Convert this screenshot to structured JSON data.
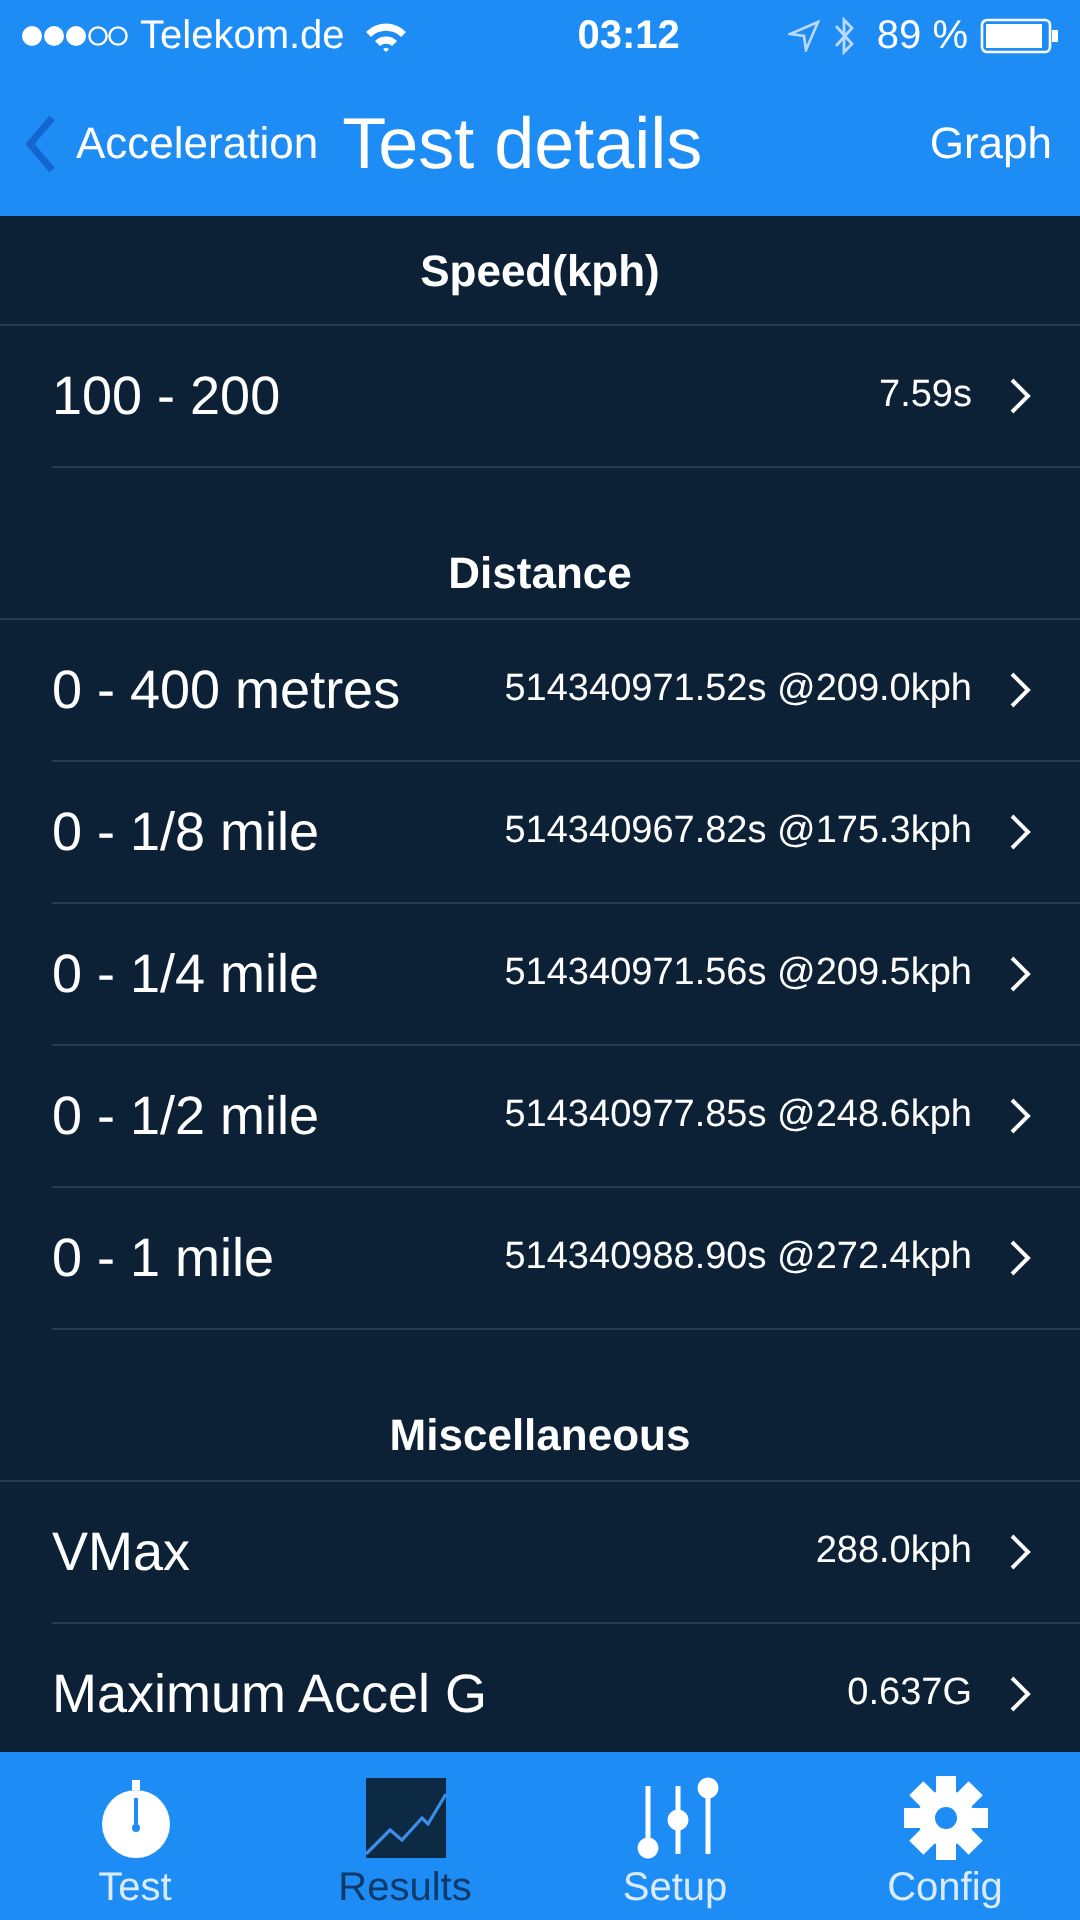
{
  "status_bar": {
    "carrier": "Telekom.de",
    "time": "03:12",
    "battery": "89 %"
  },
  "nav_bar": {
    "back": "Acceleration",
    "title": "Test details",
    "action": "Graph"
  },
  "sections": [
    {
      "title": "Speed(kph)",
      "rows": [
        {
          "label": "100 - 200",
          "detail": "7.59s"
        }
      ]
    },
    {
      "title": "Distance",
      "rows": [
        {
          "label": "0 - 400 metres",
          "detail": "514340971.52s @209.0kph"
        },
        {
          "label": "0 - 1/8 mile",
          "detail": "514340967.82s @175.3kph"
        },
        {
          "label": "0 - 1/4 mile",
          "detail": "514340971.56s @209.5kph"
        },
        {
          "label": "0 - 1/2 mile",
          "detail": "514340977.85s @248.6kph"
        },
        {
          "label": "0 - 1 mile",
          "detail": "514340988.90s @272.4kph"
        }
      ]
    },
    {
      "title": "Miscellaneous",
      "rows": [
        {
          "label": "VMax",
          "detail": "288.0kph"
        },
        {
          "label": "Maximum Accel G",
          "detail": "0.637G"
        }
      ]
    }
  ],
  "tab_bar": [
    {
      "kind": "stopwatch",
      "label": "Test",
      "selected": false
    },
    {
      "kind": "chart",
      "label": "Results",
      "selected": true
    },
    {
      "kind": "sliders",
      "label": "Setup",
      "selected": false
    },
    {
      "kind": "gear",
      "label": "Config",
      "selected": false
    }
  ]
}
